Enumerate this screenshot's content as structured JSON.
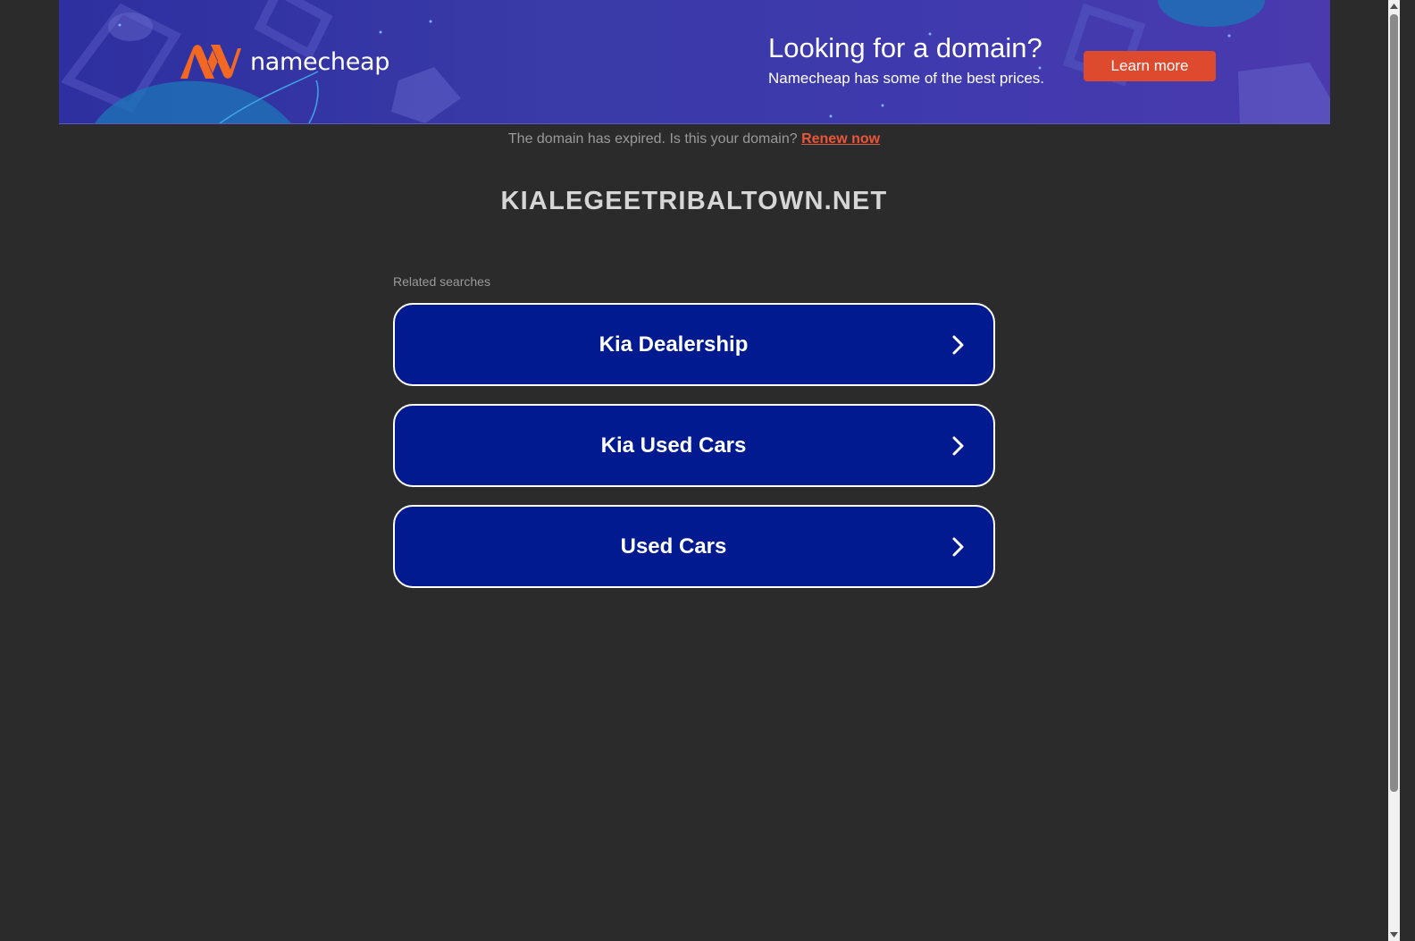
{
  "banner": {
    "brand": "namecheap",
    "title": "Looking for a domain?",
    "subtitle": "Namecheap has some of the best prices.",
    "cta_label": "Learn more",
    "brand_color": "#f26822"
  },
  "notice": {
    "text": "The domain has expired. Is this your domain?",
    "link_label": "Renew now"
  },
  "domain": "KIALEGEETRIBALTOWN.NET",
  "related": {
    "label": "Related searches",
    "items": [
      {
        "label": "Kia Dealership"
      },
      {
        "label": "Kia Used Cars"
      },
      {
        "label": "Used Cars"
      }
    ]
  },
  "colors": {
    "background": "#2b2b2b",
    "button_bg": "#021a8f",
    "cta": "#dd4a2e",
    "link": "#e8563c"
  },
  "icons": {
    "chevron": "chevron-right-icon",
    "logo": "namecheap-logo-icon"
  }
}
